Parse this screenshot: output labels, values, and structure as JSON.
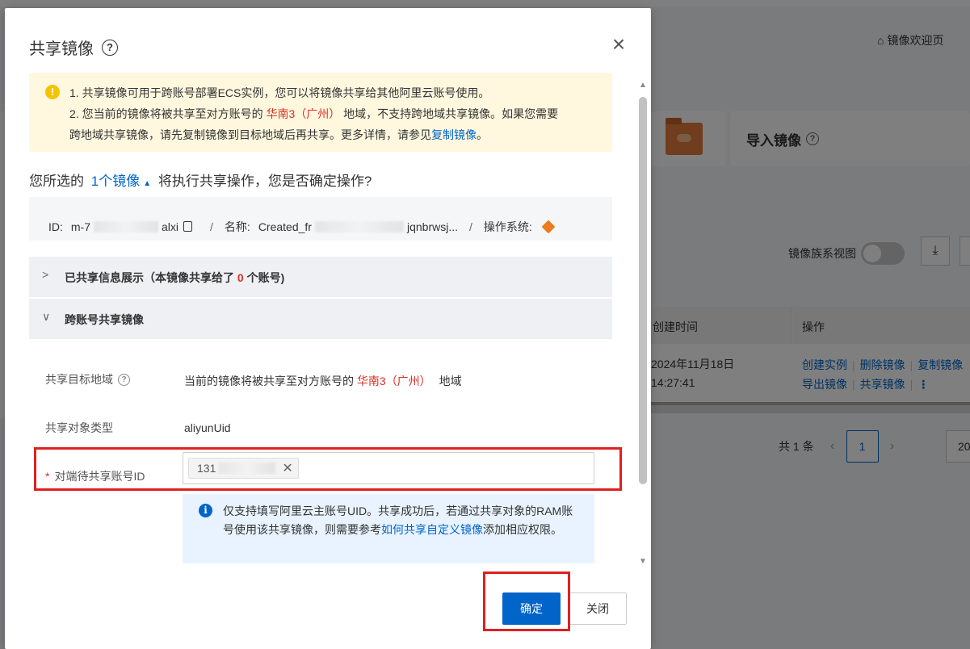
{
  "background": {
    "home_link": "镜像欢迎页",
    "import_card_label": "导入镜像",
    "family_view_label": "镜像族系视图",
    "table": {
      "col_created": "创建时间",
      "col_actions": "操作",
      "created_value_line1": "2024年11月18日",
      "created_value_line2": "14:27:41",
      "actions_row1": [
        "创建实例",
        "删除镜像",
        "复制镜像"
      ],
      "actions_row2": [
        "导出镜像",
        "共享镜像"
      ],
      "more": "⋮"
    },
    "pager": {
      "total": "共 1 条",
      "current_page": "1",
      "page_size": "20"
    }
  },
  "dialog": {
    "title": "共享镜像",
    "close_glyph": "×",
    "warning": {
      "line1": "1. 共享镜像可用于跨账号部署ECS实例，您可以将镜像共享给其他阿里云账号使用。",
      "line2_prefix": "2. 您当前的镜像将被共享至对方账号的",
      "region": "华南3（广州）",
      "line2_suffix": "地域，不支持跨地域共享镜像。如果您需要",
      "line3_prefix": "跨地域共享镜像，请先复制镜像到目标地域后再共享。更多详情，请参见",
      "line3_link": "复制镜像",
      "line3_suffix": "。"
    },
    "confirm": {
      "prefix": "您所选的",
      "link": "1个镜像",
      "suffix": "将执行共享操作，您是否确定操作?"
    },
    "image_info": {
      "id_label": "ID:",
      "id_prefix": "m-7",
      "id_suffix": "alxi",
      "name_label": "名称:",
      "name_prefix": "Created_fr",
      "name_suffix": "jqnbrwsj...",
      "os_label": "操作系统:"
    },
    "shared_info_header": {
      "prefix": "已共享信息展示（本镜像共享给了",
      "count": "0",
      "suffix": "个账号)"
    },
    "cross_account_header": "跨账号共享镜像",
    "fields": {
      "region_label": "共享目标地域",
      "region_value_prefix": "当前的镜像将被共享至对方账号的",
      "region_value_region": "华南3（广州）",
      "region_value_suffix": "地域",
      "type_label": "共享对象类型",
      "type_value": "aliyunUid",
      "uid_required_mark": "*",
      "uid_label": "对端待共享账号ID",
      "uid_tag_prefix": "131"
    },
    "hint": {
      "text1": "仅支持填写阿里云主账号UID。共享成功后，若通过共享对象的RAM账号使用该共享镜像，则需要参考",
      "link": "如何共享自定义镜像",
      "text2": "添加相应权限。"
    },
    "buttons": {
      "ok": "确定",
      "close": "关闭"
    }
  }
}
